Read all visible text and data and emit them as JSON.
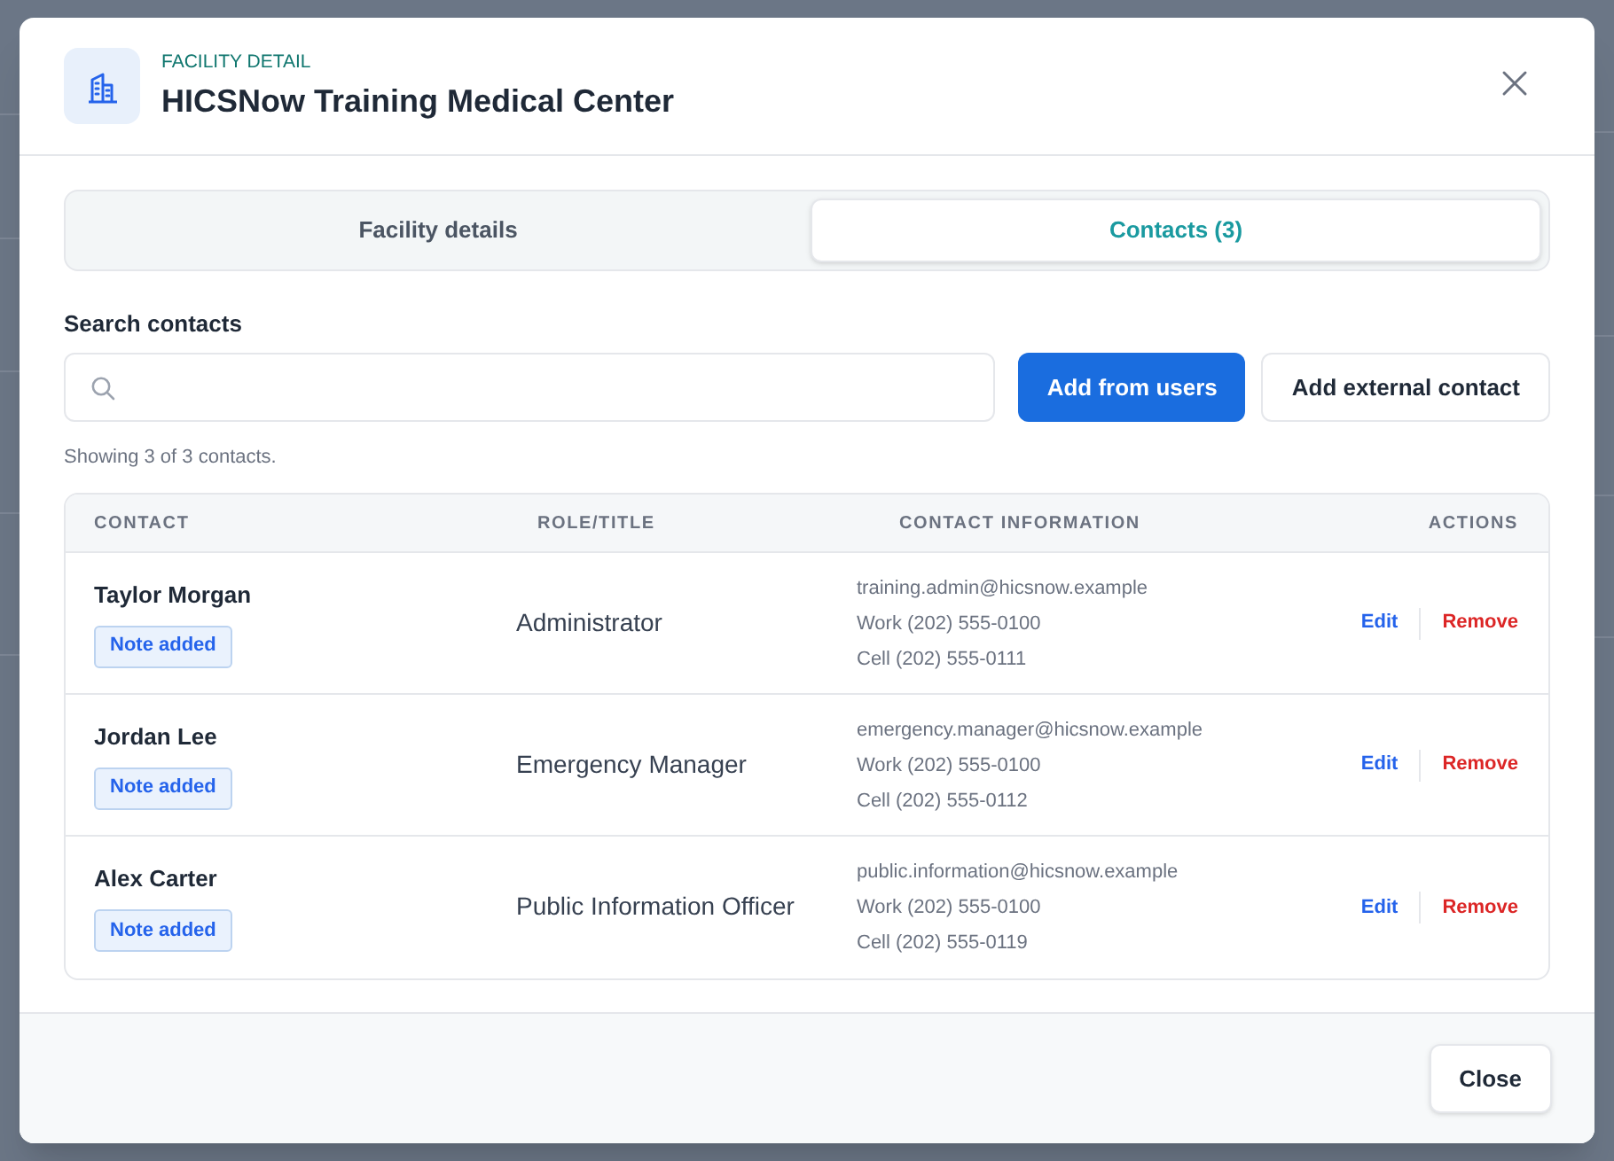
{
  "dialog": {
    "eyebrow": "FACILITY DETAIL",
    "title": "HICSNow Training Medical Center"
  },
  "tabs": [
    {
      "label": "Facility details",
      "selected": false
    },
    {
      "label": "Contacts (3)",
      "selected": true
    }
  ],
  "search": {
    "label": "Search contacts"
  },
  "buttons": [
    {
      "label": "Add from users",
      "kind": "primary"
    },
    {
      "label": "Add external contact",
      "kind": "secondary"
    }
  ],
  "result_count": "Showing 3 of 3 contacts.",
  "table": {
    "columns": [
      "CONTACT",
      "ROLE/TITLE",
      "CONTACT INFORMATION",
      "ACTIONS"
    ],
    "rows": [
      {
        "name": "Taylor Morgan",
        "badge": "Note added",
        "role": "Administrator",
        "contact_info": [
          "training.admin@hicsnow.example",
          "Work (202) 555-0100",
          "Cell (202) 555-0111"
        ],
        "actions": [
          {
            "label": "Edit",
            "kind": "edit"
          },
          {
            "label": "Remove",
            "kind": "danger"
          }
        ]
      },
      {
        "name": "Jordan Lee",
        "badge": "Note added",
        "role": "Emergency Manager",
        "contact_info": [
          "emergency.manager@hicsnow.example",
          "Work (202) 555-0100",
          "Cell (202) 555-0112"
        ],
        "actions": [
          {
            "label": "Edit",
            "kind": "edit"
          },
          {
            "label": "Remove",
            "kind": "danger"
          }
        ]
      },
      {
        "name": "Alex Carter",
        "badge": "Note added",
        "role": "Public Information Officer",
        "contact_info": [
          "public.information@hicsnow.example",
          "Work (202) 555-0100",
          "Cell (202) 555-0119"
        ],
        "actions": [
          {
            "label": "Edit",
            "kind": "edit"
          },
          {
            "label": "Remove",
            "kind": "danger"
          }
        ]
      }
    ]
  },
  "footer": {
    "buttons": [
      "Close"
    ]
  }
}
